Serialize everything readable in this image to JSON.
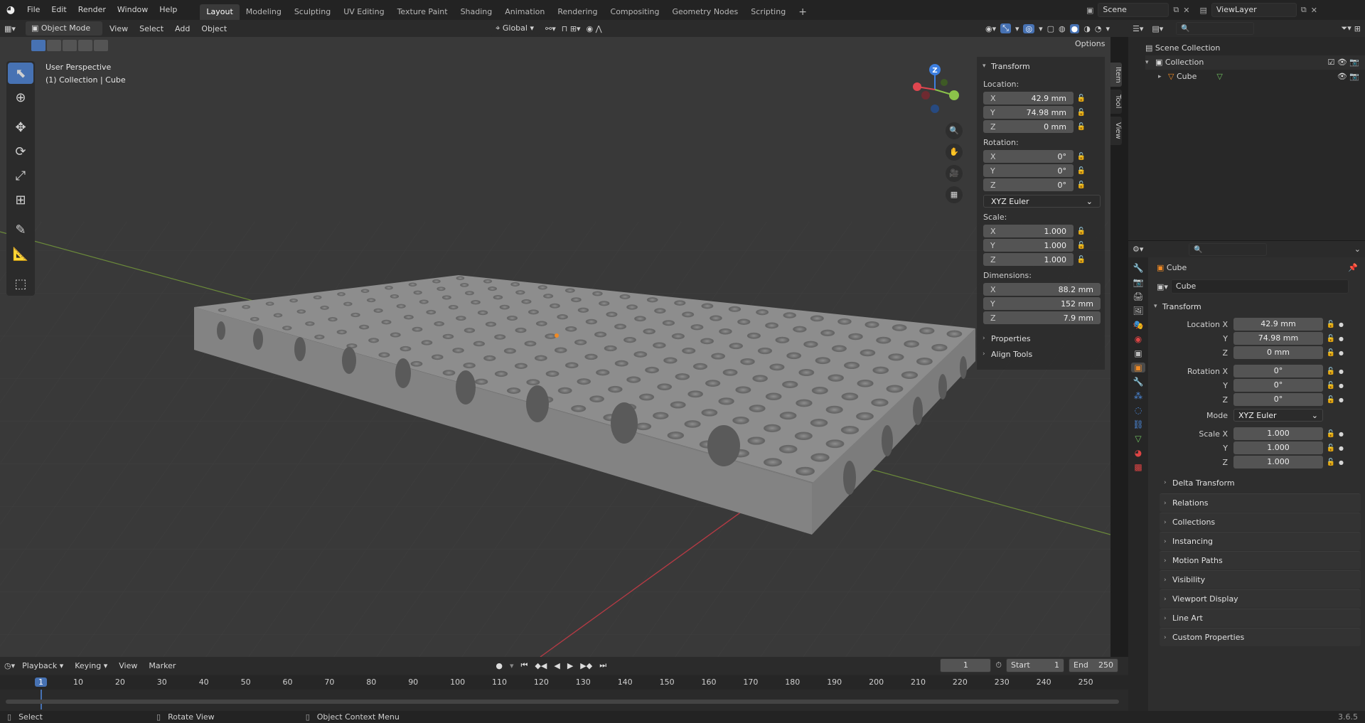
{
  "menu": [
    "File",
    "Edit",
    "Render",
    "Window",
    "Help"
  ],
  "workspaces": [
    "Layout",
    "Modeling",
    "Sculpting",
    "UV Editing",
    "Texture Paint",
    "Shading",
    "Animation",
    "Rendering",
    "Compositing",
    "Geometry Nodes",
    "Scripting"
  ],
  "active_workspace": "Layout",
  "scene": "Scene",
  "view_layer": "ViewLayer",
  "viewport_header": {
    "mode": "Object Mode",
    "menus": [
      "View",
      "Select",
      "Add",
      "Object"
    ],
    "orientation": "Global",
    "options": "Options"
  },
  "viewport": {
    "perspective": "User Perspective",
    "context": "(1) Collection | Cube"
  },
  "gizmo": {
    "z": "Z"
  },
  "side_tabs": [
    "Item",
    "Tool",
    "View"
  ],
  "npanel": {
    "title": "Transform",
    "location_label": "Location:",
    "location": [
      {
        "axis": "X",
        "value": "42.9 mm"
      },
      {
        "axis": "Y",
        "value": "74.98 mm"
      },
      {
        "axis": "Z",
        "value": "0 mm"
      }
    ],
    "rotation_label": "Rotation:",
    "rotation": [
      {
        "axis": "X",
        "value": "0°"
      },
      {
        "axis": "Y",
        "value": "0°"
      },
      {
        "axis": "Z",
        "value": "0°"
      }
    ],
    "rotation_mode": "XYZ Euler",
    "scale_label": "Scale:",
    "scale": [
      {
        "axis": "X",
        "value": "1.000"
      },
      {
        "axis": "Y",
        "value": "1.000"
      },
      {
        "axis": "Z",
        "value": "1.000"
      }
    ],
    "dimensions_label": "Dimensions:",
    "dimensions": [
      {
        "axis": "X",
        "value": "88.2 mm"
      },
      {
        "axis": "Y",
        "value": "152 mm"
      },
      {
        "axis": "Z",
        "value": "7.9 mm"
      }
    ],
    "sections": [
      "Properties",
      "Align Tools"
    ]
  },
  "outliner": {
    "root": "Scene Collection",
    "collection": "Collection",
    "object": "Cube"
  },
  "properties": {
    "object_name": "Cube",
    "data_name": "Cube",
    "transform_title": "Transform",
    "rows": [
      {
        "label": "Location X",
        "value": "42.9 mm"
      },
      {
        "label": "Y",
        "value": "74.98 mm"
      },
      {
        "label": "Z",
        "value": "0 mm"
      },
      {
        "label": "Rotation X",
        "value": "0°"
      },
      {
        "label": "Y",
        "value": "0°"
      },
      {
        "label": "Z",
        "value": "0°"
      }
    ],
    "mode_label": "Mode",
    "mode_value": "XYZ Euler",
    "scale_rows": [
      {
        "label": "Scale X",
        "value": "1.000"
      },
      {
        "label": "Y",
        "value": "1.000"
      },
      {
        "label": "Z",
        "value": "1.000"
      }
    ],
    "delta": "Delta Transform",
    "sections": [
      "Relations",
      "Collections",
      "Instancing",
      "Motion Paths",
      "Visibility",
      "Viewport Display",
      "Line Art",
      "Custom Properties"
    ]
  },
  "timeline": {
    "menus": [
      "Playback",
      "Keying",
      "View",
      "Marker"
    ],
    "current_frame": "1",
    "start_label": "Start",
    "start": "1",
    "end_label": "End",
    "end": "250",
    "ticks": [
      "1",
      "10",
      "20",
      "30",
      "40",
      "50",
      "60",
      "70",
      "80",
      "90",
      "100",
      "110",
      "120",
      "130",
      "140",
      "150",
      "160",
      "170",
      "180",
      "190",
      "200",
      "210",
      "220",
      "230",
      "240",
      "250"
    ]
  },
  "status": {
    "select": "Select",
    "rotate": "Rotate View",
    "context_menu": "Object Context Menu",
    "version": "3.6.5"
  },
  "colors": {
    "accent": "#4772b3",
    "x_axis": "#e0464f",
    "y_axis": "#8bc34a",
    "z_axis": "#3d7fe0"
  }
}
